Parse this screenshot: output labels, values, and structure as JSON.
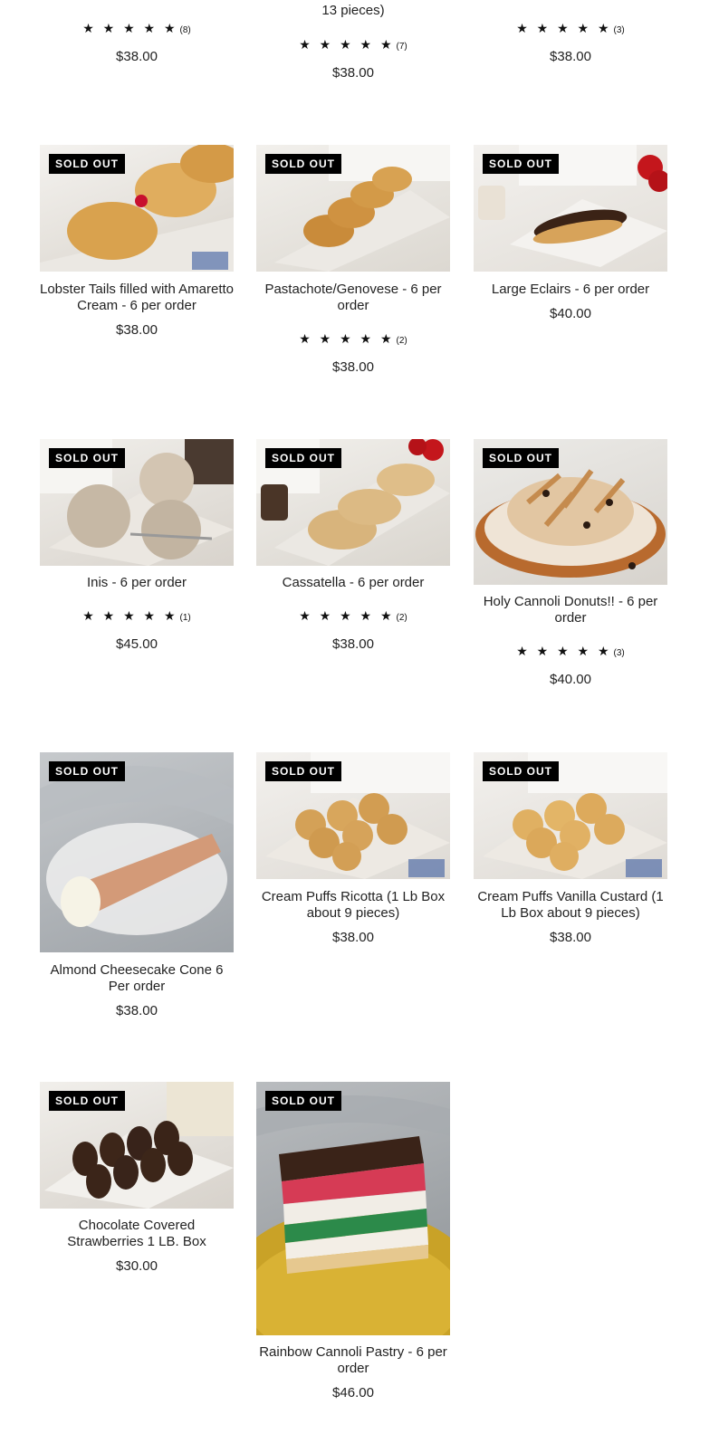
{
  "top_row": [
    {
      "title_fragment": "",
      "stars": "★ ★ ★ ★ ★",
      "review_count": "(8)",
      "price": "$38.00"
    },
    {
      "title_fragment": "13 pieces)",
      "stars": "★ ★ ★ ★ ★",
      "review_count": "(7)",
      "price": "$38.00"
    },
    {
      "title_fragment": "",
      "stars": "★ ★ ★ ★ ★",
      "review_count": "(3)",
      "price": "$38.00"
    }
  ],
  "products": [
    {
      "title": "Lobster Tails filled with Amaretto Cream - 6 per order",
      "badge": "SOLD OUT",
      "price": "$38.00",
      "stars": "",
      "review_count": "",
      "image_icon": "lobster-tail-pastry-photo"
    },
    {
      "title": "Pastachote/Genovese - 6 per order",
      "badge": "SOLD OUT",
      "price": "$38.00",
      "stars": "★ ★ ★ ★ ★",
      "review_count": "(2)",
      "image_icon": "genovese-pastry-photo"
    },
    {
      "title": "Large Eclairs - 6 per order",
      "badge": "SOLD OUT",
      "price": "$40.00",
      "stars": "",
      "review_count": "",
      "image_icon": "eclair-photo"
    },
    {
      "title": "Inis - 6 per order",
      "badge": "SOLD OUT",
      "price": "$45.00",
      "stars": "★ ★ ★ ★ ★",
      "review_count": "(1)",
      "image_icon": "inis-pastry-photo"
    },
    {
      "title": "Cassatella - 6 per order",
      "badge": "SOLD OUT",
      "price": "$38.00",
      "stars": "★ ★ ★ ★ ★",
      "review_count": "(2)",
      "image_icon": "cassatella-photo"
    },
    {
      "title": "Holy Cannoli Donuts!! - 6 per order",
      "badge": "SOLD OUT",
      "price": "$40.00",
      "stars": "★ ★ ★ ★ ★",
      "review_count": "(3)",
      "image_icon": "cannoli-donut-photo"
    },
    {
      "title": "Almond Cheesecake Cone 6 Per order",
      "badge": "SOLD OUT",
      "price": "$38.00",
      "stars": "",
      "review_count": "",
      "image_icon": "cheesecake-cone-photo"
    },
    {
      "title": "Cream Puffs Ricotta (1 Lb Box about 9 pieces)",
      "badge": "SOLD OUT",
      "price": "$38.00",
      "stars": "",
      "review_count": "",
      "image_icon": "cream-puffs-ricotta-photo"
    },
    {
      "title": "Cream Puffs Vanilla Custard (1 Lb Box about 9 pieces)",
      "badge": "SOLD OUT",
      "price": "$38.00",
      "stars": "",
      "review_count": "",
      "image_icon": "cream-puffs-vanilla-photo"
    },
    {
      "title": "Chocolate Covered Strawberries 1 LB. Box",
      "badge": "SOLD OUT",
      "price": "$30.00",
      "stars": "",
      "review_count": "",
      "image_icon": "chocolate-strawberries-photo"
    },
    {
      "title": "Rainbow Cannoli Pastry - 6 per order",
      "badge": "SOLD OUT",
      "price": "$46.00",
      "stars": "",
      "review_count": "",
      "image_icon": "rainbow-cake-photo"
    }
  ],
  "colors": {
    "badge_bg": "#000000",
    "badge_text": "#ffffff",
    "text": "#222222",
    "background": "#ffffff"
  }
}
